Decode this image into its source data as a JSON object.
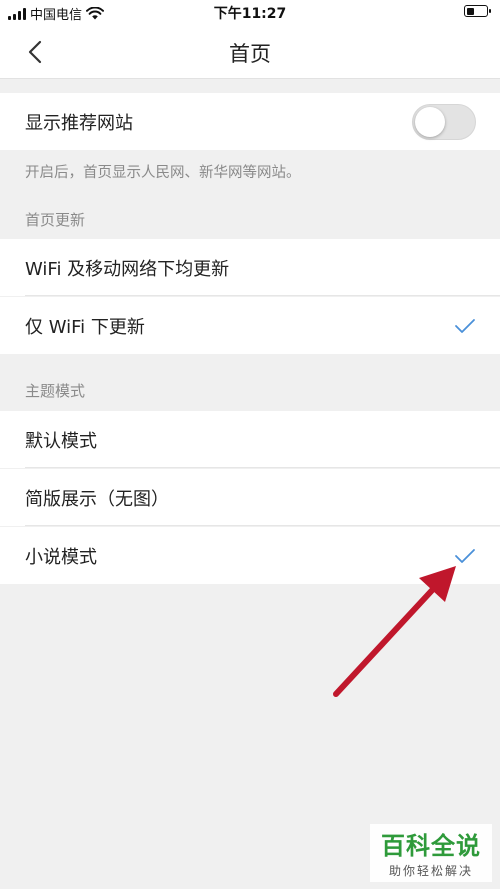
{
  "status_bar": {
    "carrier": "中国电信",
    "time": "下午11:27"
  },
  "nav": {
    "title": "首页",
    "back_icon": "chevron-left-icon"
  },
  "recommend": {
    "label": "显示推荐网站",
    "toggle_on": false,
    "hint": "开启后，首页显示人民网、新华网等网站。"
  },
  "update_section": {
    "header": "首页更新",
    "options": [
      {
        "label": "WiFi 及移动网络下均更新",
        "selected": false
      },
      {
        "label": "仅 WiFi 下更新",
        "selected": true
      }
    ]
  },
  "theme_section": {
    "header": "主题模式",
    "options": [
      {
        "label": "默认模式",
        "selected": false
      },
      {
        "label": "简版展示（无图）",
        "selected": false
      },
      {
        "label": "小说模式",
        "selected": true
      }
    ]
  },
  "colors": {
    "check": "#4a90d9",
    "arrow": "#c0172c",
    "watermark": "#2e9a3a"
  },
  "watermark": {
    "title": "百科全说",
    "subtitle": "助你轻松解决"
  }
}
